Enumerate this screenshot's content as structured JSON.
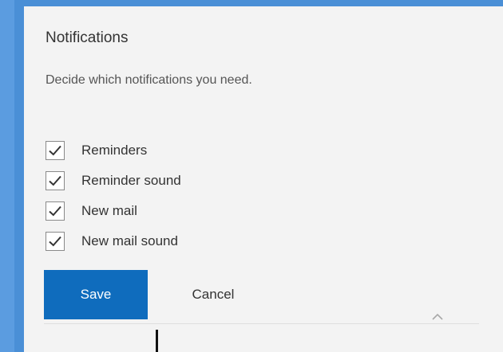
{
  "colors": {
    "background": "#4a8fd6",
    "panel": "#f3f3f3",
    "accent": "#0f6cbd"
  },
  "notifications": {
    "title": "Notifications",
    "description": "Decide which notifications you need.",
    "options": [
      {
        "label": "Reminders",
        "checked": true
      },
      {
        "label": "Reminder sound",
        "checked": true
      },
      {
        "label": "New mail",
        "checked": true
      },
      {
        "label": "New mail sound",
        "checked": true
      }
    ],
    "save_label": "Save",
    "cancel_label": "Cancel",
    "collapse_icon": "chevron-up-icon"
  }
}
